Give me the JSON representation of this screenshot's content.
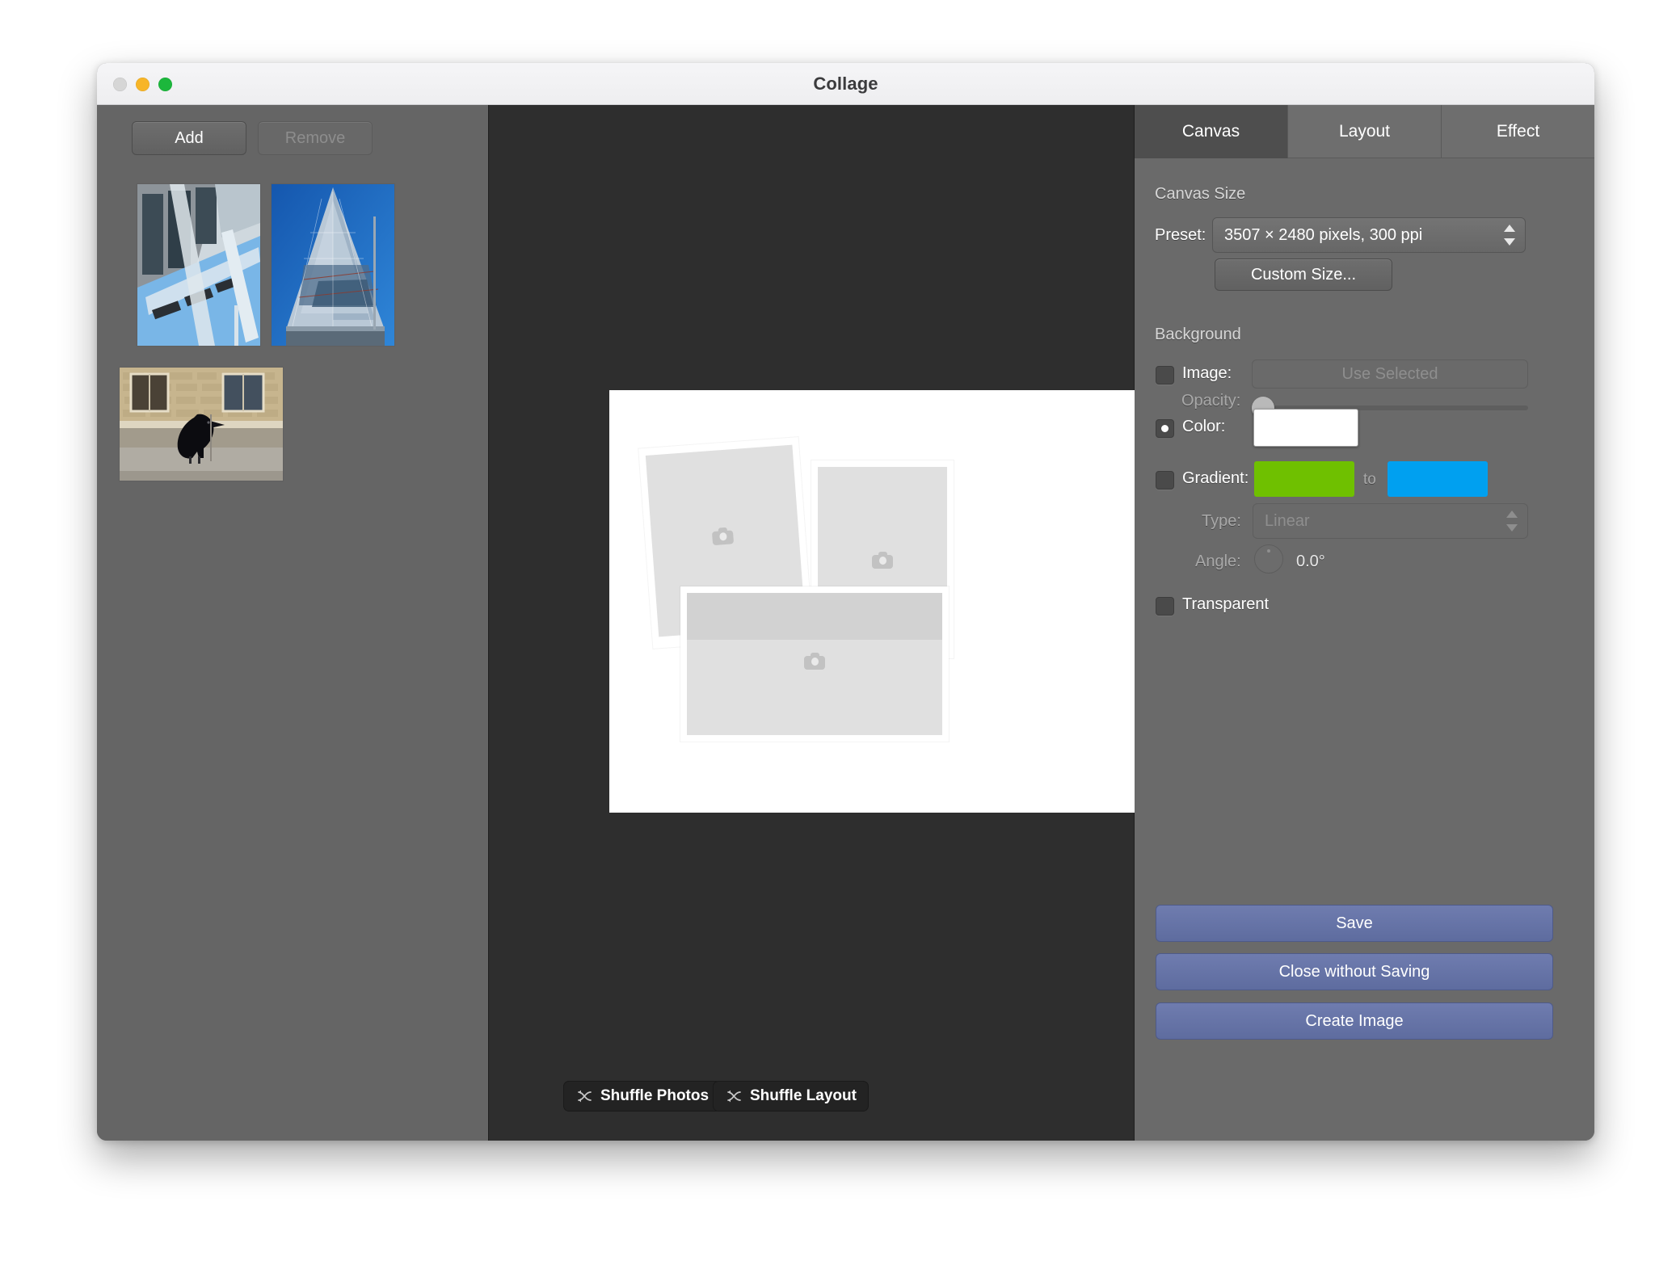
{
  "window": {
    "title": "Collage",
    "traffic_lights": [
      "close",
      "minimize",
      "zoom"
    ]
  },
  "sidebar": {
    "add_label": "Add",
    "remove_label": "Remove",
    "thumbnails": [
      {
        "name": "glass-atrium-photo",
        "alt": "Glass atrium with steel framing against blue sky"
      },
      {
        "name": "skyscraper-photo",
        "alt": "Upward view of a glass skyscraper"
      },
      {
        "name": "raven-photo",
        "alt": "Black raven standing on stone ledge by a stone building"
      }
    ]
  },
  "center": {
    "shuffle_photos_label": "Shuffle Photos",
    "shuffle_layout_label": "Shuffle Layout",
    "canvas_background": "#ffffff",
    "placeholder_count": 3
  },
  "inspector": {
    "tabs": [
      {
        "label": "Canvas",
        "active": true
      },
      {
        "label": "Layout",
        "active": false
      },
      {
        "label": "Effect",
        "active": false
      }
    ],
    "canvas_size": {
      "section_label": "Canvas Size",
      "preset_label": "Preset:",
      "preset_value": "3507 × 2480 pixels, 300 ppi",
      "custom_size_label": "Custom Size..."
    },
    "background": {
      "section_label": "Background",
      "image_label": "Image:",
      "image_checked": false,
      "use_selected_label": "Use Selected",
      "opacity_label": "Opacity:",
      "opacity_value": "0",
      "color_label": "Color:",
      "color_selected": true,
      "color_value": "#ffffff",
      "gradient_label": "Gradient:",
      "gradient_checked": false,
      "gradient_from": "#6fc000",
      "gradient_to": "#00a0f0",
      "gradient_to_label": "to",
      "type_label": "Type:",
      "type_value": "Linear",
      "angle_label": "Angle:",
      "angle_value": "0.0°",
      "transparent_label": "Transparent",
      "transparent_checked": false
    },
    "actions": {
      "save_label": "Save",
      "close_without_saving_label": "Close without Saving",
      "create_image_label": "Create Image"
    }
  }
}
